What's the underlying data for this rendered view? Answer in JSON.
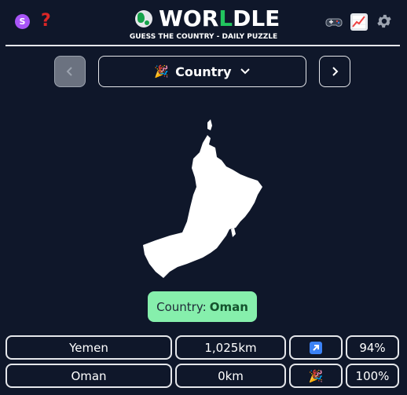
{
  "header": {
    "avatar_letter": "S",
    "help_icon": "question-mark-icon",
    "logo_prefix": "WOR",
    "logo_highlight": "L",
    "logo_suffix": "DLE",
    "tagline": "GUESS THE COUNTRY - DAILY PUZZLE",
    "icons": [
      "gamepad-icon",
      "chart-icon",
      "gear-icon"
    ]
  },
  "nav": {
    "prev_icon": "chevron-left-icon",
    "next_icon": "chevron-right-icon",
    "selector_emoji": "🎉",
    "selector_label": "Country",
    "selector_icon": "chevron-down-icon"
  },
  "map": {
    "country_shape": "Oman"
  },
  "answer": {
    "label": "Country:",
    "value": "Oman"
  },
  "guesses": [
    {
      "country": "Yemen",
      "distance": "1,025km",
      "direction": "↗",
      "proximity": "94%"
    },
    {
      "country": "Oman",
      "distance": "0km",
      "direction": "🎉",
      "proximity": "100%"
    }
  ],
  "colors": {
    "background": "#0f172a",
    "accent": "#22c55e",
    "answer_bg": "#86efac",
    "arrow_bg": "#3b82f6"
  }
}
